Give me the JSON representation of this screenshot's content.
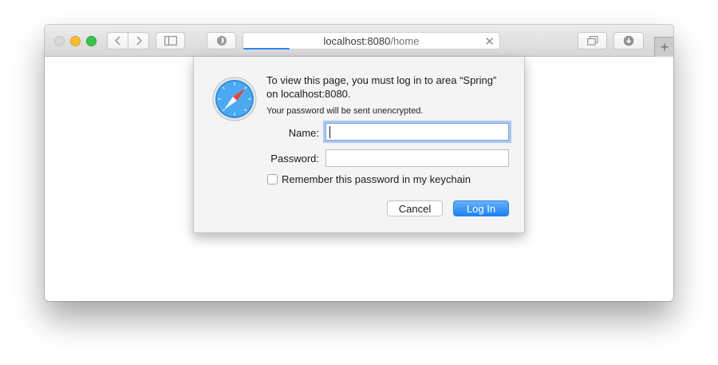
{
  "browser": {
    "url_host": "localhost:8080",
    "url_path": "/home",
    "load_progress": 0.18
  },
  "dialog": {
    "message": "To view this page, you must log in to area “Spring” on localhost:8080.",
    "note": "Your password will be sent unencrypted.",
    "name_label": "Name:",
    "name_value": "",
    "password_label": "Password:",
    "password_value": "",
    "remember_label": "Remember this password in my keychain",
    "remember_checked": false,
    "cancel_label": "Cancel",
    "login_label": "Log In"
  },
  "colors": {
    "accent": "#1b83f6",
    "focus_ring": "#a9c8f0"
  }
}
